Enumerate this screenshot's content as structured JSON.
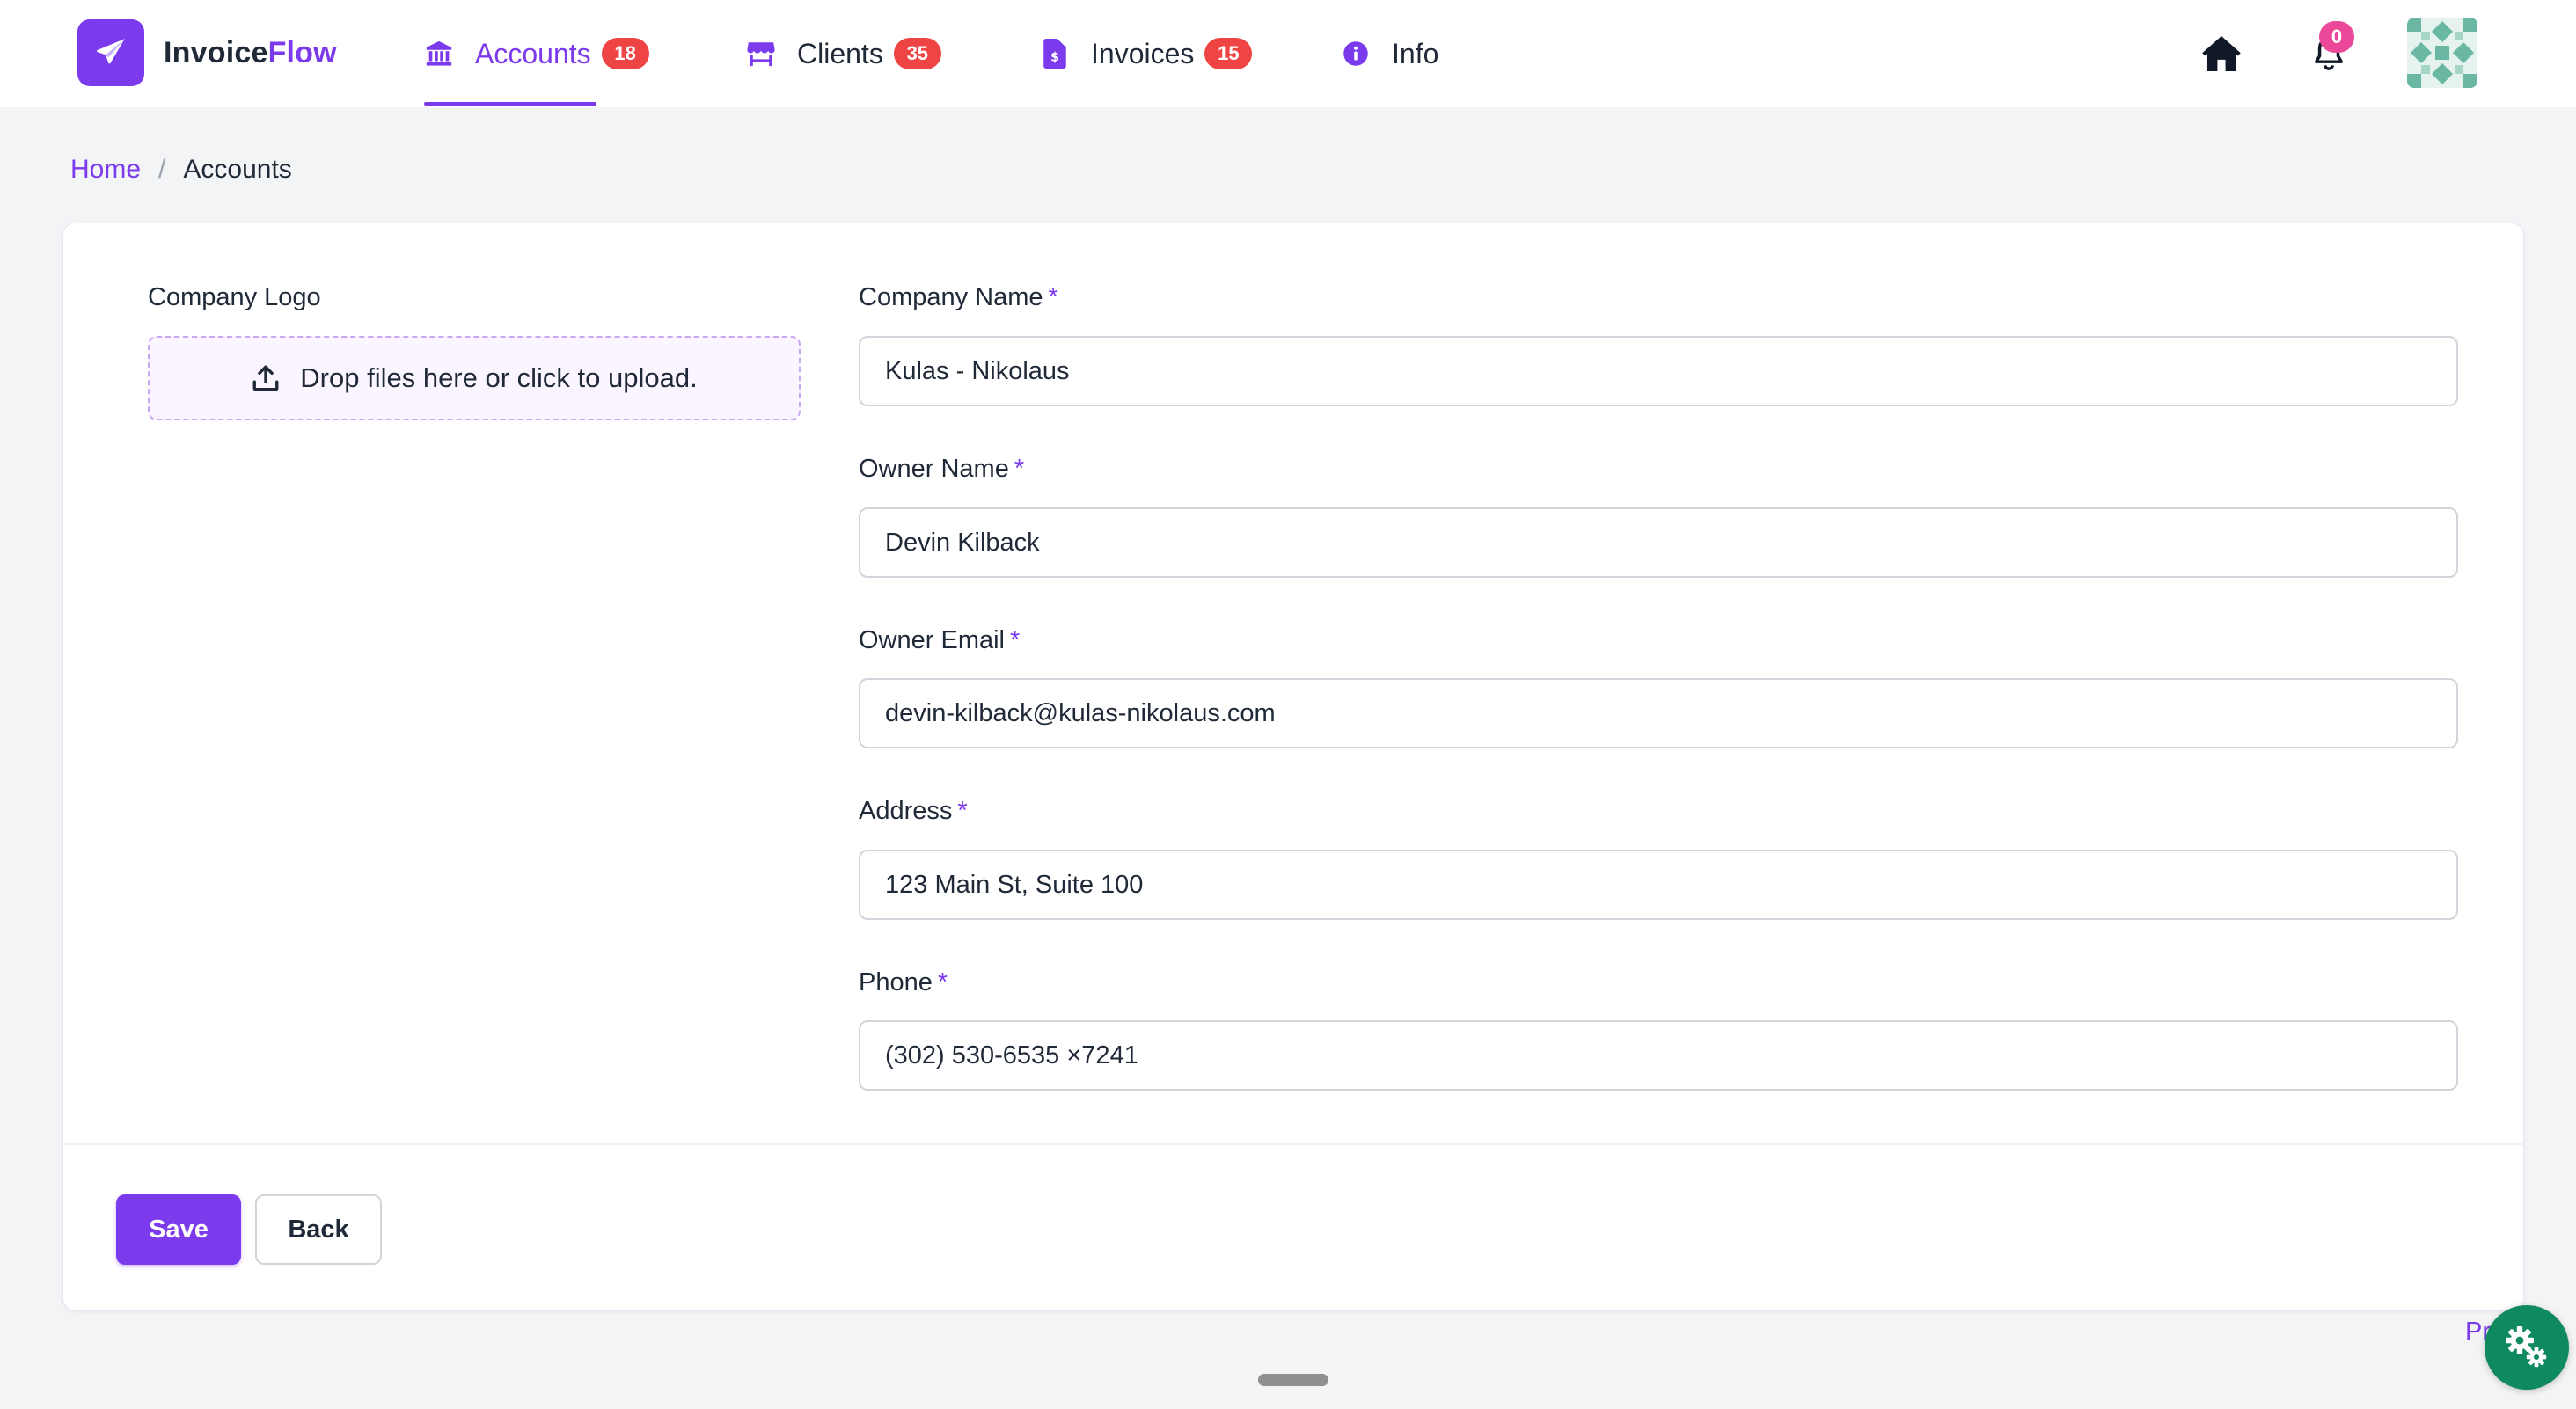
{
  "brand": {
    "name_part1": "Invoice",
    "name_part2": "Flow"
  },
  "nav": {
    "accounts": {
      "label": "Accounts",
      "count": "18"
    },
    "clients": {
      "label": "Clients",
      "count": "35"
    },
    "invoices": {
      "label": "Invoices",
      "count": "15"
    },
    "info": {
      "label": "Info"
    }
  },
  "topright": {
    "notification_count": "0"
  },
  "breadcrumb": {
    "home": "Home",
    "separator": "/",
    "current": "Accounts"
  },
  "form": {
    "logo_label": "Company Logo",
    "dropzone_text": "Drop files here or click to upload.",
    "required_mark": "*",
    "company_name": {
      "label": "Company Name",
      "value": "Kulas - Nikolaus"
    },
    "owner_name": {
      "label": "Owner Name",
      "value": "Devin Kilback"
    },
    "owner_email": {
      "label": "Owner Email",
      "value": "devin-kilback@kulas-nikolaus.com"
    },
    "address": {
      "label": "Address",
      "value": "123 Main St, Suite 100"
    },
    "phone": {
      "label": "Phone",
      "value": "(302) 530-6535 ×7241"
    }
  },
  "actions": {
    "save": "Save",
    "back": "Back"
  },
  "footer": {
    "partial_link": "Pr"
  },
  "colors": {
    "accent": "#7c3aed",
    "badge": "#ef4444",
    "notification": "#ec4899",
    "fab": "#0f8a5f"
  },
  "icons": {
    "brand": "paper-plane-icon",
    "accounts": "bank-icon",
    "clients": "store-icon",
    "invoices": "invoice-file-icon",
    "info": "info-circle-icon",
    "home": "home-icon",
    "bell": "bell-icon",
    "upload": "upload-icon",
    "settings": "gears-icon"
  }
}
